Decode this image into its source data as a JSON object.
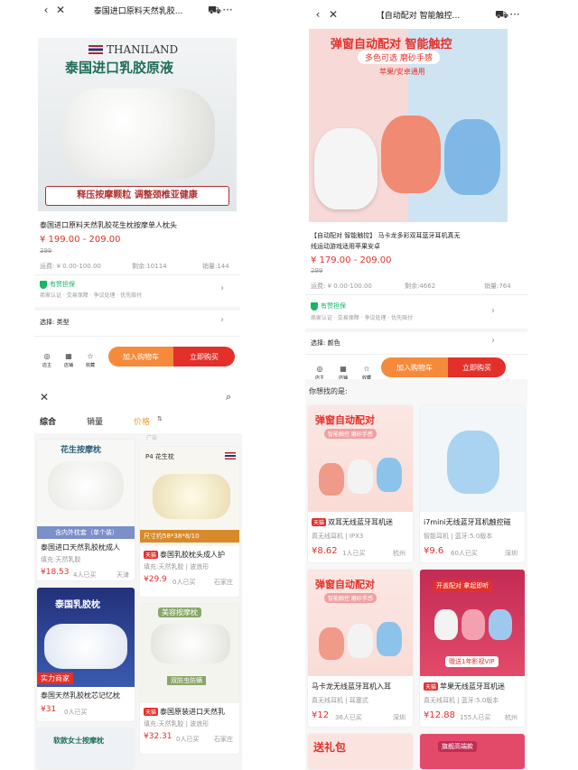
{
  "left_top": {
    "title": "泰国进口原料天然乳胶...",
    "banner_brand": "THANILAND",
    "banner_title": "泰国进口乳胶原液",
    "banner_slogan": "释压按摩颗粒 调整颈椎亚健康",
    "product_title": "泰国进口原料天然乳胶花生枕按摩单人枕头",
    "price": "¥ 199.00 - 209.00",
    "old_price": "399",
    "shipping": "运费: ¥ 0.00-100.00",
    "stock": "剩余:10114",
    "sales": "销量:144",
    "guarantee": "有赞担保",
    "guarantee_sub": "商家认证 · 交易保障 · 争议处理 · 优先赔付",
    "select_label": "选择: 类型",
    "footer": {
      "shop": "店主",
      "store": "店铺",
      "fav": "收藏",
      "cart": "加入购物车",
      "buy": "立即购买"
    }
  },
  "right_top": {
    "title": "【自动配对 智能触控...",
    "banner_title": "弹窗自动配对 智能触控",
    "banner_sub": "多色可选 磨砂手感",
    "banner_sub2": "苹果/安卓通用",
    "product_title_1": "【自动配对 智能触控】 马卡龙多彩双耳蓝牙耳机真无",
    "product_title_2": "线运动游戏适用苹果安卓",
    "price": "¥ 179.00 - 209.00",
    "old_price": "299",
    "shipping": "运费: ¥ 0.00-100.00",
    "stock": "剩余:4662",
    "sales": "销量:764",
    "guarantee": "有赞担保",
    "guarantee_sub": "商家认证 · 交易保障 · 争议处理 · 优先赔付",
    "select_label": "选择: 颜色",
    "footer": {
      "shop": "店主",
      "store": "店铺",
      "fav": "收藏",
      "cart": "加入购物车",
      "buy": "立即购买"
    },
    "recommend": "你想找的是:",
    "cards": [
      {
        "banner": "弹窗自动配对",
        "banner_sub": "智能触控 磨砂手感",
        "tag": "天猫",
        "title": "双耳无线蓝牙耳机迷",
        "sub": "真无线耳机 | IPX3",
        "price": "8.62",
        "sold": "1人已买",
        "city": "杭州"
      },
      {
        "banner": "",
        "banner_sub": "",
        "tag": "",
        "title": "i7mini无线蓝牙耳机触控磁",
        "sub": "智能耳机 | 蓝牙:5.0版本",
        "price": "9.6",
        "sold": "60人已买",
        "city": "深圳"
      },
      {
        "banner": "弹窗自动配对",
        "banner_sub": "智能触控 磨砂手感",
        "tag": "",
        "title": "马卡龙无线蓝牙耳机入耳",
        "sub": "真无线耳机 | 耳塞式",
        "price": "12",
        "sold": "36人已买",
        "city": "深圳"
      },
      {
        "banner": "开盖配对 拿起即听",
        "banner_sub": "赠送1年影视VIP",
        "tag": "天猫",
        "title": "苹果无线蓝牙耳机迷",
        "sub": "真无线耳机 | 蓝牙:5.0版本",
        "price": "12.88",
        "sold": "155人已买",
        "city": "杭州"
      }
    ],
    "bottom_cards": [
      "送礼包",
      "旗舰高端款"
    ]
  },
  "left_bottom": {
    "sort_tabs": [
      "综合",
      "销量",
      "价格"
    ],
    "ad": "广告",
    "cards": [
      {
        "banner": "花生按摩枕",
        "banner_sub": "含内外枕套（单个装）",
        "title": "泰国进口天然乳胶枕成人",
        "sub": "填充:天然乳胶",
        "price": "18.53",
        "sold": "4人已买",
        "city": "天津",
        "tag": ""
      },
      {
        "banner": "P4 花生枕",
        "banner_sub": "尺寸约58*38*8/10",
        "title": "泰国乳胶枕头成人护",
        "sub": "填充:天然乳胶 | 波浪形",
        "price": "29.9",
        "sold": "0人已买",
        "city": "石家庄",
        "tag": "天猫"
      },
      {
        "banner": "泰国乳胶枕",
        "banner_sub": "实力商家",
        "title": "泰国天然乳胶枕芯记忆枕",
        "sub": "",
        "price": "31",
        "sold": "0人已买",
        "city": "",
        "tag": ""
      },
      {
        "banner": "美容按摩枕",
        "banner_sub": "双防虫防螨",
        "title": "泰国原装进口天然乳",
        "sub": "填充:天然乳胶 | 波浪形",
        "price": "32.31",
        "sold": "0人已买",
        "city": "石家庄",
        "tag": "天猫"
      }
    ],
    "bottom_card": "软款女士按摩枕"
  },
  "colors": {
    "accent": "#e3302a",
    "orange": "#f58a3b",
    "green": "#18b566"
  }
}
